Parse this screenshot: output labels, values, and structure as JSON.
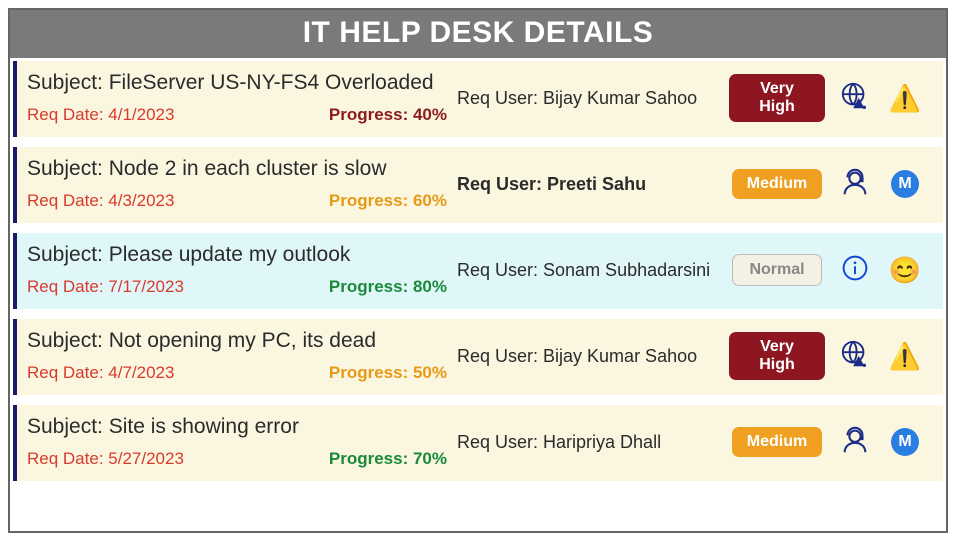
{
  "title": "IT HELP DESK DETAILS",
  "labels": {
    "subject_prefix": "Subject: ",
    "req_date_prefix": "Req Date: ",
    "progress_prefix": "Progress: ",
    "req_user_prefix": "Req User: "
  },
  "priority_labels": {
    "veryhigh": "Very High",
    "medium": "Medium",
    "normal": "Normal"
  },
  "icon_letter_m": "M",
  "tickets": [
    {
      "subject": "FileServer US-NY-FS4 Overloaded",
      "req_date": "4/1/2023",
      "progress": "40%",
      "progress_color": "red",
      "req_user": "Bijay Kumar Sahoo",
      "user_bold": false,
      "priority": "veryhigh",
      "icon1": "globe-alert",
      "icon2": "warning",
      "selected": false
    },
    {
      "subject": "Node 2 in each cluster is slow",
      "req_date": "4/3/2023",
      "progress": "60%",
      "progress_color": "amber",
      "req_user": "Preeti Sahu",
      "user_bold": true,
      "priority": "medium",
      "icon1": "agent",
      "icon2": "m-circle",
      "selected": false
    },
    {
      "subject": "Please update my outlook",
      "req_date": "7/17/2023",
      "progress": "80%",
      "progress_color": "green",
      "req_user": "Sonam Subhadarsini",
      "user_bold": false,
      "priority": "normal",
      "icon1": "info",
      "icon2": "smile",
      "selected": true
    },
    {
      "subject": "Not opening my PC, its dead",
      "req_date": "4/7/2023",
      "progress": "50%",
      "progress_color": "amber",
      "req_user": "Bijay Kumar Sahoo",
      "user_bold": false,
      "priority": "veryhigh",
      "icon1": "globe-alert",
      "icon2": "warning",
      "selected": false
    },
    {
      "subject": "Site is showing error",
      "req_date": "5/27/2023",
      "progress": "70%",
      "progress_color": "green",
      "req_user": "Haripriya Dhall",
      "user_bold": false,
      "priority": "medium",
      "icon1": "agent",
      "icon2": "m-circle",
      "selected": false
    }
  ]
}
